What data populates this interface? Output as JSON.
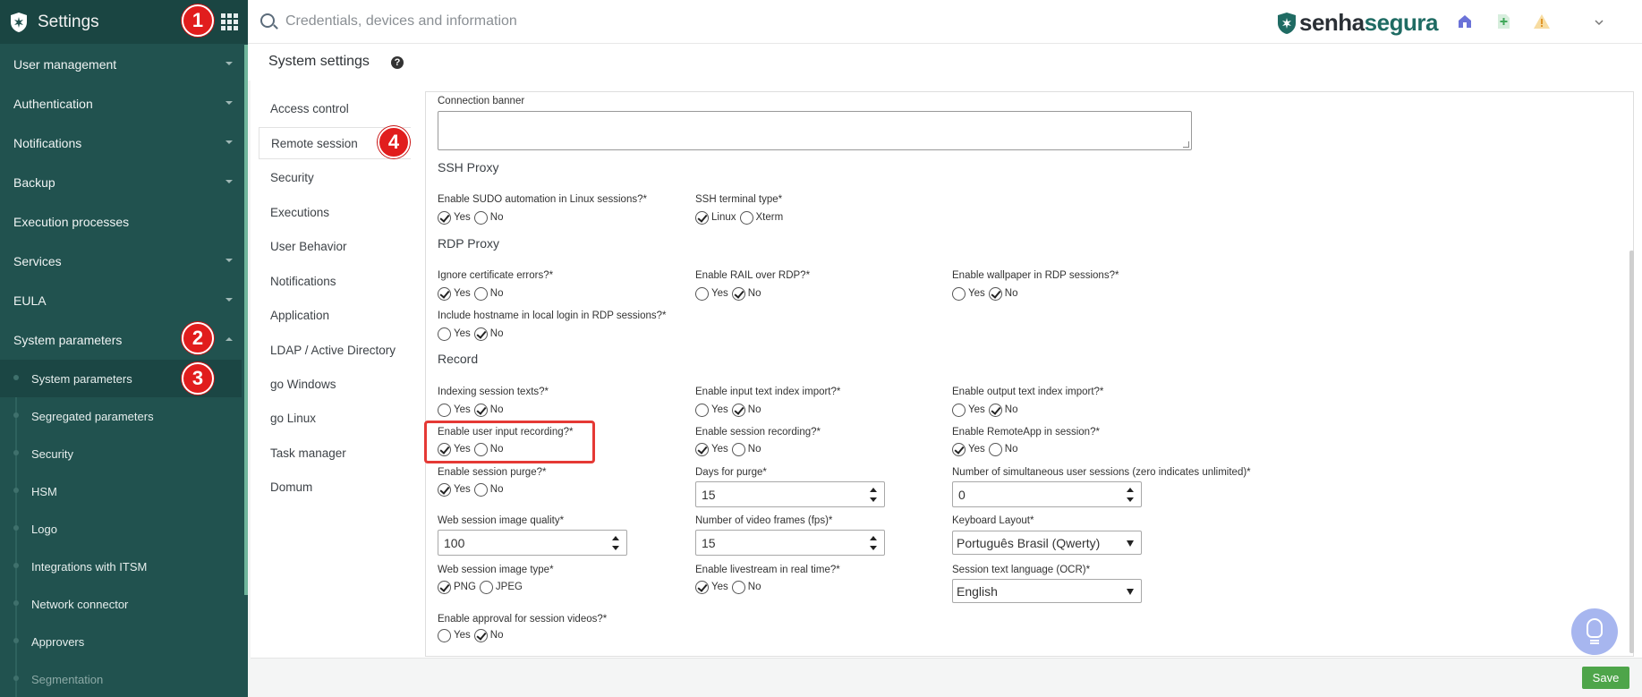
{
  "app": {
    "title": "Settings",
    "brand_name_a": "senha",
    "brand_name_b": "segura",
    "brand_color": "#1f6b63",
    "sidebar_color": "#21524f"
  },
  "search": {
    "placeholder": "Credentials, devices and information"
  },
  "sidebar": {
    "items": [
      {
        "label": "User management"
      },
      {
        "label": "Authentication"
      },
      {
        "label": "Notifications"
      },
      {
        "label": "Backup"
      },
      {
        "label": "Execution processes"
      },
      {
        "label": "Services"
      },
      {
        "label": "EULA"
      },
      {
        "label": "System parameters"
      }
    ],
    "sub_items": [
      {
        "label": "System parameters"
      },
      {
        "label": "Segregated parameters"
      },
      {
        "label": "Security"
      },
      {
        "label": "HSM"
      },
      {
        "label": "Logo"
      },
      {
        "label": "Integrations with ITSM"
      },
      {
        "label": "Network connector"
      },
      {
        "label": "Approvers"
      },
      {
        "label": "Segmentation"
      }
    ]
  },
  "page": {
    "title": "System settings",
    "help_icon": "?"
  },
  "subnav": [
    {
      "label": "Access control"
    },
    {
      "label": "Remote session"
    },
    {
      "label": "Security"
    },
    {
      "label": "Executions"
    },
    {
      "label": "User Behavior"
    },
    {
      "label": "Notifications"
    },
    {
      "label": "Application"
    },
    {
      "label": "LDAP / Active Directory"
    },
    {
      "label": "go Windows"
    },
    {
      "label": "go Linux"
    },
    {
      "label": "Task manager"
    },
    {
      "label": "Domum"
    }
  ],
  "form": {
    "connection_banner": {
      "label": "Connection banner",
      "value": ""
    },
    "sections": {
      "ssh": "SSH Proxy",
      "rdp": "RDP Proxy",
      "record": "Record"
    },
    "options": {
      "yes": "Yes",
      "no": "No",
      "linux": "Linux",
      "xterm": "Xterm",
      "png": "PNG",
      "jpeg": "JPEG"
    },
    "sudo": {
      "label": "Enable SUDO automation in Linux sessions?*",
      "value": "Yes"
    },
    "ssh_terminal": {
      "label": "SSH terminal type*",
      "value": "Linux"
    },
    "ignore_cert": {
      "label": "Ignore certificate errors?*",
      "value": "Yes"
    },
    "rail": {
      "label": "Enable RAIL over RDP?*",
      "value": "No"
    },
    "wallpaper": {
      "label": "Enable wallpaper in RDP sessions?*",
      "value": "No"
    },
    "hostname": {
      "label": "Include hostname in local login in RDP sessions?*",
      "value": "No"
    },
    "indexing": {
      "label": "Indexing session texts?*",
      "value": "No"
    },
    "input_index": {
      "label": "Enable input text index import?*",
      "value": "No"
    },
    "output_index": {
      "label": "Enable output text index import?*",
      "value": "No"
    },
    "user_input": {
      "label": "Enable user input recording?*",
      "value": "Yes"
    },
    "session_rec": {
      "label": "Enable session recording?*",
      "value": "Yes"
    },
    "remoteapp": {
      "label": "Enable RemoteApp in session?*",
      "value": "Yes"
    },
    "purge": {
      "label": "Enable session purge?*",
      "value": "Yes"
    },
    "days_purge": {
      "label": "Days for purge*",
      "value": "15"
    },
    "simul": {
      "label": "Number of simultaneous user sessions (zero indicates unlimited)*",
      "value": "0"
    },
    "img_quality": {
      "label": "Web session image quality*",
      "value": "100"
    },
    "fps": {
      "label": "Number of video frames (fps)*",
      "value": "15"
    },
    "keyboard": {
      "label": "Keyboard Layout*",
      "value": "Português Brasil (Qwerty)"
    },
    "img_type": {
      "label": "Web session image type*",
      "value": "PNG"
    },
    "livestream": {
      "label": "Enable livestream in real time?*",
      "value": "Yes"
    },
    "ocr_lang": {
      "label": "Session text language (OCR)*",
      "value": "English"
    },
    "approval": {
      "label": "Enable approval for session videos?*",
      "value": "No"
    }
  },
  "badges": [
    "1",
    "2",
    "3",
    "4"
  ],
  "footer": {
    "save_label": "Save",
    "save_color": "#4ea54a"
  },
  "annotation_color": "#e53935"
}
